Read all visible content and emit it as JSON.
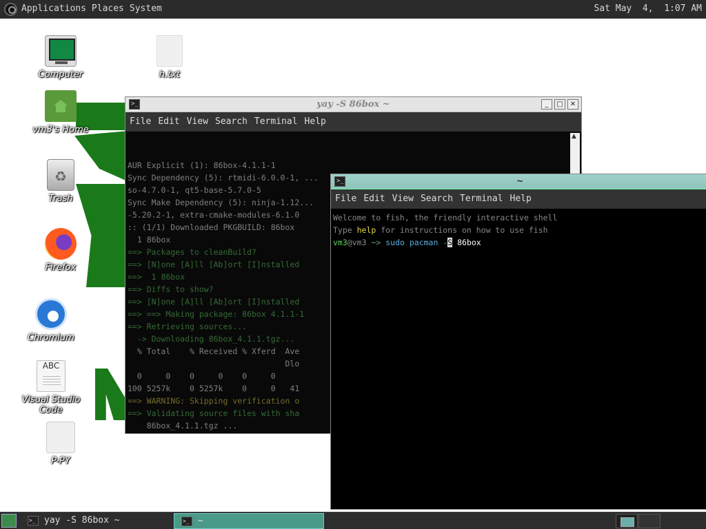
{
  "top_panel": {
    "menus": [
      "Applications",
      "Places",
      "System"
    ],
    "clock": "Sat May  4,  1:07 AM"
  },
  "desktop_icons": [
    {
      "label": "Computer",
      "icon": "computer-icon"
    },
    {
      "label": "h.txt",
      "icon": "text-file-icon"
    },
    {
      "label": "vm3's Home",
      "icon": "home-folder-icon"
    },
    {
      "label": "Trash",
      "icon": "trash-icon"
    },
    {
      "label": "Firefox",
      "icon": "firefox-icon"
    },
    {
      "label": "Chromium",
      "icon": "chromium-icon"
    },
    {
      "label": "Visual Studio Code",
      "icon": "text-editor-icon"
    },
    {
      "label": "P-PY",
      "icon": "blank-file-icon"
    }
  ],
  "window_back": {
    "title": "yay -S 86box ~",
    "menu": [
      "File",
      "Edit",
      "View",
      "Search",
      "Terminal",
      "Help"
    ],
    "lines": [
      "",
      "",
      "AUR Explicit (1): 86box-4.1.1-1",
      "Sync Dependency (5): rtmidi-6.0.0-1, ...",
      "so-4.7.0-1, qt5-base-5.7.0-5",
      "Sync Make Dependency (5): ninja-1.12...",
      "-5.20.2-1, extra-cmake-modules-6.1.0",
      ":: (1/1) Downloaded PKGBUILD: 86box",
      "  1 86box",
      "==> Packages to cleanBuild?",
      "==> [N]one [A]ll [Ab]ort [I]nstalled",
      "==>  1 86box",
      "==> Diffs to show?",
      "==> [N]one [A]ll [Ab]ort [I]nstalled",
      "==> ==> Making package: 86box 4.1.1-1",
      "==> Retrieving sources...",
      "  -> Downloading 86box_4.1.1.tgz...",
      "  % Total    % Received % Xferd  Ave",
      "                                 Dlo",
      "  0     0    0     0    0     0    ",
      "100 5257k    0 5257k    0     0   41",
      "==> WARNING: Skipping verification o",
      "==> Validating source files with sha",
      "    86box_4.1.1.tgz ... "
    ]
  },
  "window_front": {
    "title": "~",
    "menu": [
      "File",
      "Edit",
      "View",
      "Search",
      "Terminal",
      "Help"
    ],
    "line1": "Welcome to fish, the friendly interactive shell",
    "line2_pre": "Type ",
    "line2_help": "help",
    "line2_post": " for instructions on how to use fish",
    "prompt_user": "vm3",
    "prompt_at": "@",
    "prompt_host": "vm3",
    "prompt_dir": " ~",
    "prompt_sym": "> ",
    "cmd": "sudo pacman",
    "arg_pre": " -",
    "arg_cursor": "S",
    "arg_post": " 86box"
  },
  "taskbar": {
    "item1": "yay -S 86box ~",
    "item2": "~"
  }
}
